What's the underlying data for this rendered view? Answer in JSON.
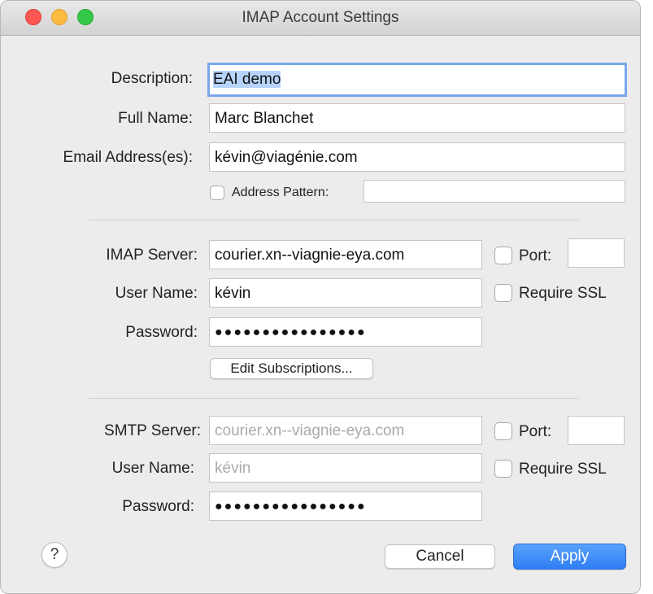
{
  "window": {
    "title": "IMAP Account Settings"
  },
  "account": {
    "description_label": "Description:",
    "description_value": "EAI demo",
    "full_name_label": "Full Name:",
    "full_name_value": "Marc Blanchet",
    "email_label": "Email Address(es):",
    "email_value": "kévin@viagénie.com",
    "address_pattern_label": "Address Pattern:",
    "address_pattern_value": "",
    "address_pattern_checked": false
  },
  "imap": {
    "server_label": "IMAP Server:",
    "server_value": "courier.xn--viagnie-eya.com",
    "port_label": "Port:",
    "port_value": "",
    "port_checked": false,
    "user_label": "User Name:",
    "user_value": "kévin",
    "require_ssl_label": "Require SSL",
    "require_ssl_checked": false,
    "password_label": "Password:",
    "password_mask": "●●●●●●●●●●●●●●●●",
    "edit_subscriptions_label": "Edit Subscriptions..."
  },
  "smtp": {
    "server_label": "SMTP Server:",
    "server_placeholder": "courier.xn--viagnie-eya.com",
    "port_label": "Port:",
    "port_value": "",
    "port_checked": false,
    "user_label": "User Name:",
    "user_placeholder": "kévin",
    "require_ssl_label": "Require SSL",
    "require_ssl_checked": false,
    "password_label": "Password:",
    "password_mask": "●●●●●●●●●●●●●●●●"
  },
  "footer": {
    "help_label": "?",
    "cancel_label": "Cancel",
    "apply_label": "Apply"
  },
  "colors": {
    "accent": "#3a87f6",
    "focus_ring": "#7aa7ea",
    "selection": "#b6d3fb",
    "close": "#fc5753",
    "minimize": "#fdbc40",
    "maximize": "#33c748"
  },
  "icons": [
    "close-window-icon",
    "minimize-window-icon",
    "zoom-window-icon",
    "help-icon"
  ]
}
